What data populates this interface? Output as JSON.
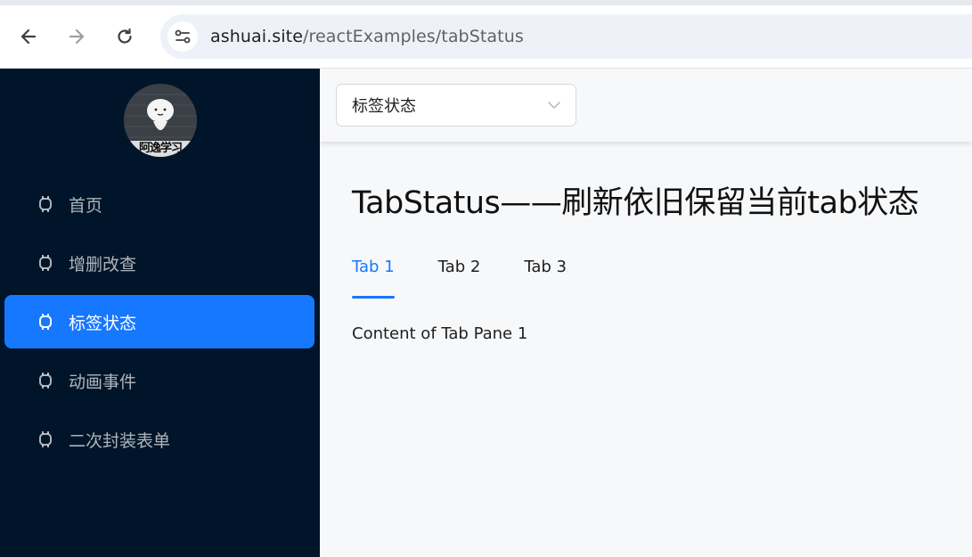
{
  "browser": {
    "url_host": "ashuai.site",
    "url_path": "/reactExamples/tabStatus"
  },
  "sidebar": {
    "avatar_caption": "阿逸学习",
    "items": [
      {
        "label": "首页",
        "icon": "android-icon",
        "active": false
      },
      {
        "label": "增删改查",
        "icon": "android-icon",
        "active": false
      },
      {
        "label": "标签状态",
        "icon": "android-icon",
        "active": true
      },
      {
        "label": "动画事件",
        "icon": "android-icon",
        "active": false
      },
      {
        "label": "二次封装表单",
        "icon": "android-icon",
        "active": false
      }
    ]
  },
  "header": {
    "select_value": "标签状态"
  },
  "main": {
    "title": "TabStatus——刷新依旧保留当前tab状态",
    "tabs": [
      {
        "label": "Tab 1",
        "active": true
      },
      {
        "label": "Tab 2",
        "active": false
      },
      {
        "label": "Tab 3",
        "active": false
      }
    ],
    "tab_content": "Content of Tab Pane 1"
  },
  "colors": {
    "sidebar_bg": "#001529",
    "accent": "#1677ff"
  }
}
